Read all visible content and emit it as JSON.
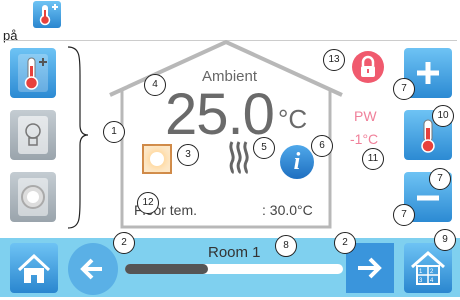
{
  "header": {
    "prefix": "på"
  },
  "house": {
    "label": "Ambient",
    "temperature": "25.0",
    "unit": "°C",
    "floor_label": "Floor tem.",
    "floor_value": ": 30.0°C"
  },
  "pw": {
    "label": "PW",
    "offset": "-1°C"
  },
  "room": {
    "name": "Room 1",
    "progress": 0.38
  },
  "callouts": [
    "1",
    "2",
    "2",
    "3",
    "4",
    "5",
    "6",
    "7",
    "7",
    "7",
    "8",
    "9",
    "10",
    "11",
    "12",
    "13"
  ],
  "colors": {
    "accent_blue": "#3a95dc",
    "bottom_bar": "#7fd0ef",
    "pw_text": "#f0809a",
    "lock_red": "#f05a6e"
  }
}
